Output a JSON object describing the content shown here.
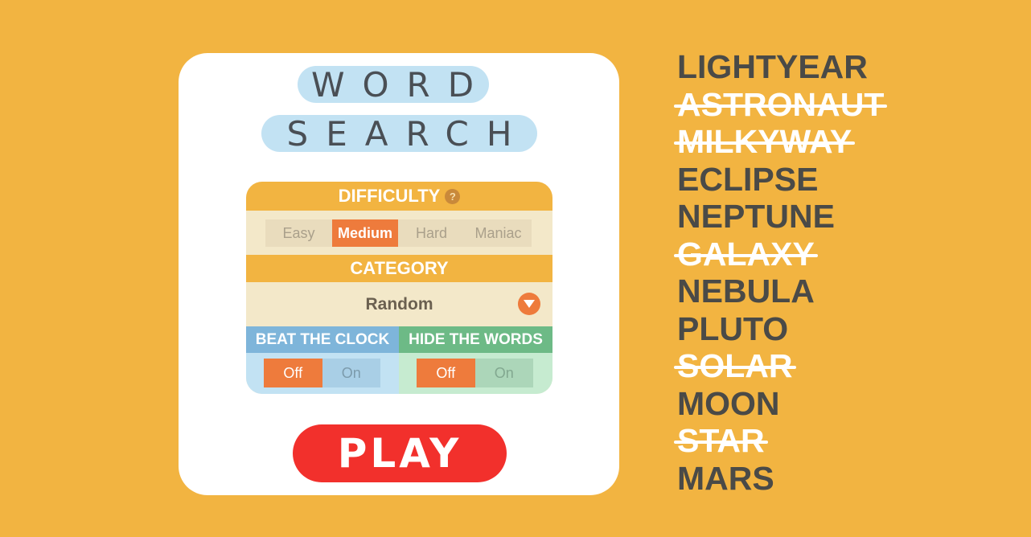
{
  "title": {
    "line1": "WORD",
    "line2": "SEARCH"
  },
  "difficulty": {
    "heading": "DIFFICULTY",
    "help": "?",
    "options": [
      "Easy",
      "Medium",
      "Hard",
      "Maniac"
    ],
    "selected": "Medium"
  },
  "category": {
    "heading": "CATEGORY",
    "value": "Random"
  },
  "beat_the_clock": {
    "heading": "BEAT THE CLOCK",
    "off_label": "Off",
    "on_label": "On",
    "state": "Off"
  },
  "hide_the_words": {
    "heading": "HIDE THE WORDS",
    "off_label": "Off",
    "on_label": "On",
    "state": "Off"
  },
  "play_label": "PLAY",
  "word_list": [
    {
      "text": "LIGHTYEAR",
      "found": false
    },
    {
      "text": "ASTRONAUT",
      "found": true
    },
    {
      "text": "MILKYWAY",
      "found": true
    },
    {
      "text": "ECLIPSE",
      "found": false
    },
    {
      "text": "NEPTUNE",
      "found": false
    },
    {
      "text": "GALAXY",
      "found": true
    },
    {
      "text": "NEBULA",
      "found": false
    },
    {
      "text": "PLUTO",
      "found": false
    },
    {
      "text": "SOLAR",
      "found": true
    },
    {
      "text": "MOON",
      "found": false
    },
    {
      "text": "STAR",
      "found": true
    },
    {
      "text": "MARS",
      "found": false
    }
  ],
  "colors": {
    "background": "#f2b441",
    "accent": "#ee7b3c",
    "play": "#f2302c",
    "title_pill": "#c2e2f3"
  }
}
